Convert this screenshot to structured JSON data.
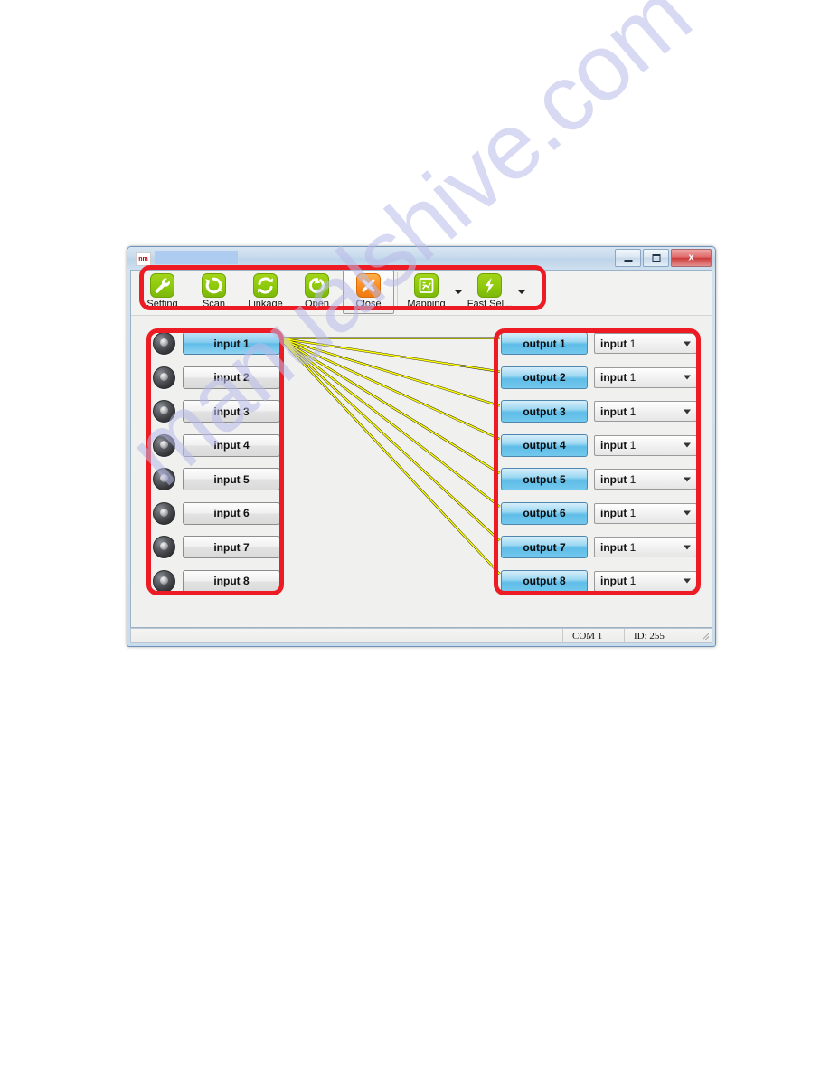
{
  "watermark": {
    "text": "manualshive.com"
  },
  "window": {
    "title": "",
    "icon_label": "nm",
    "controls": {
      "minimize": "Minimize",
      "maximize": "Maximize",
      "close": "x"
    }
  },
  "toolbar": {
    "buttons": [
      {
        "label": "Setting",
        "icon": "wrench-icon",
        "color": "#8ec90c",
        "active": false
      },
      {
        "label": "Scan",
        "icon": "refresh-icon",
        "color": "#8ec90c",
        "active": false
      },
      {
        "label": "Linkage",
        "icon": "sync-icon",
        "color": "#8ec90c",
        "active": false
      },
      {
        "label": "Open",
        "icon": "power-icon",
        "color": "#8ec90c",
        "active": false
      },
      {
        "label": "Close",
        "icon": "close-x-icon",
        "color": "#fb8c21",
        "active": true
      },
      {
        "label": "Mapping",
        "icon": "chart-icon",
        "color": "#8ec90c",
        "active": false
      },
      {
        "label": "Fast Sel...",
        "icon": "lightning-icon",
        "color": "#8ec90c",
        "active": false
      }
    ]
  },
  "inputs": [
    {
      "label": "input 1",
      "selected": true
    },
    {
      "label": "input 2",
      "selected": false
    },
    {
      "label": "input 3",
      "selected": false
    },
    {
      "label": "input 4",
      "selected": false
    },
    {
      "label": "input 5",
      "selected": false
    },
    {
      "label": "input 6",
      "selected": false
    },
    {
      "label": "input 7",
      "selected": false
    },
    {
      "label": "input 8",
      "selected": false
    }
  ],
  "outputs": [
    {
      "label": "output 1",
      "source_bold": "input",
      "source_num": "1"
    },
    {
      "label": "output 2",
      "source_bold": "input",
      "source_num": "1"
    },
    {
      "label": "output 3",
      "source_bold": "input",
      "source_num": "1"
    },
    {
      "label": "output 4",
      "source_bold": "input",
      "source_num": "1"
    },
    {
      "label": "output 5",
      "source_bold": "input",
      "source_num": "1"
    },
    {
      "label": "output 6",
      "source_bold": "input",
      "source_num": "1"
    },
    {
      "label": "output 7",
      "source_bold": "input",
      "source_num": "1"
    },
    {
      "label": "output 8",
      "source_bold": "input",
      "source_num": "1"
    }
  ],
  "status_bar": {
    "port": "COM 1",
    "id": "ID: 255"
  },
  "annotations": {
    "colors": {
      "highlight": "#ed1b23",
      "link_line": "#ffff00",
      "selected_button": "#5fbde8"
    },
    "boxes": [
      "toolbar",
      "input-group",
      "output-group"
    ]
  }
}
